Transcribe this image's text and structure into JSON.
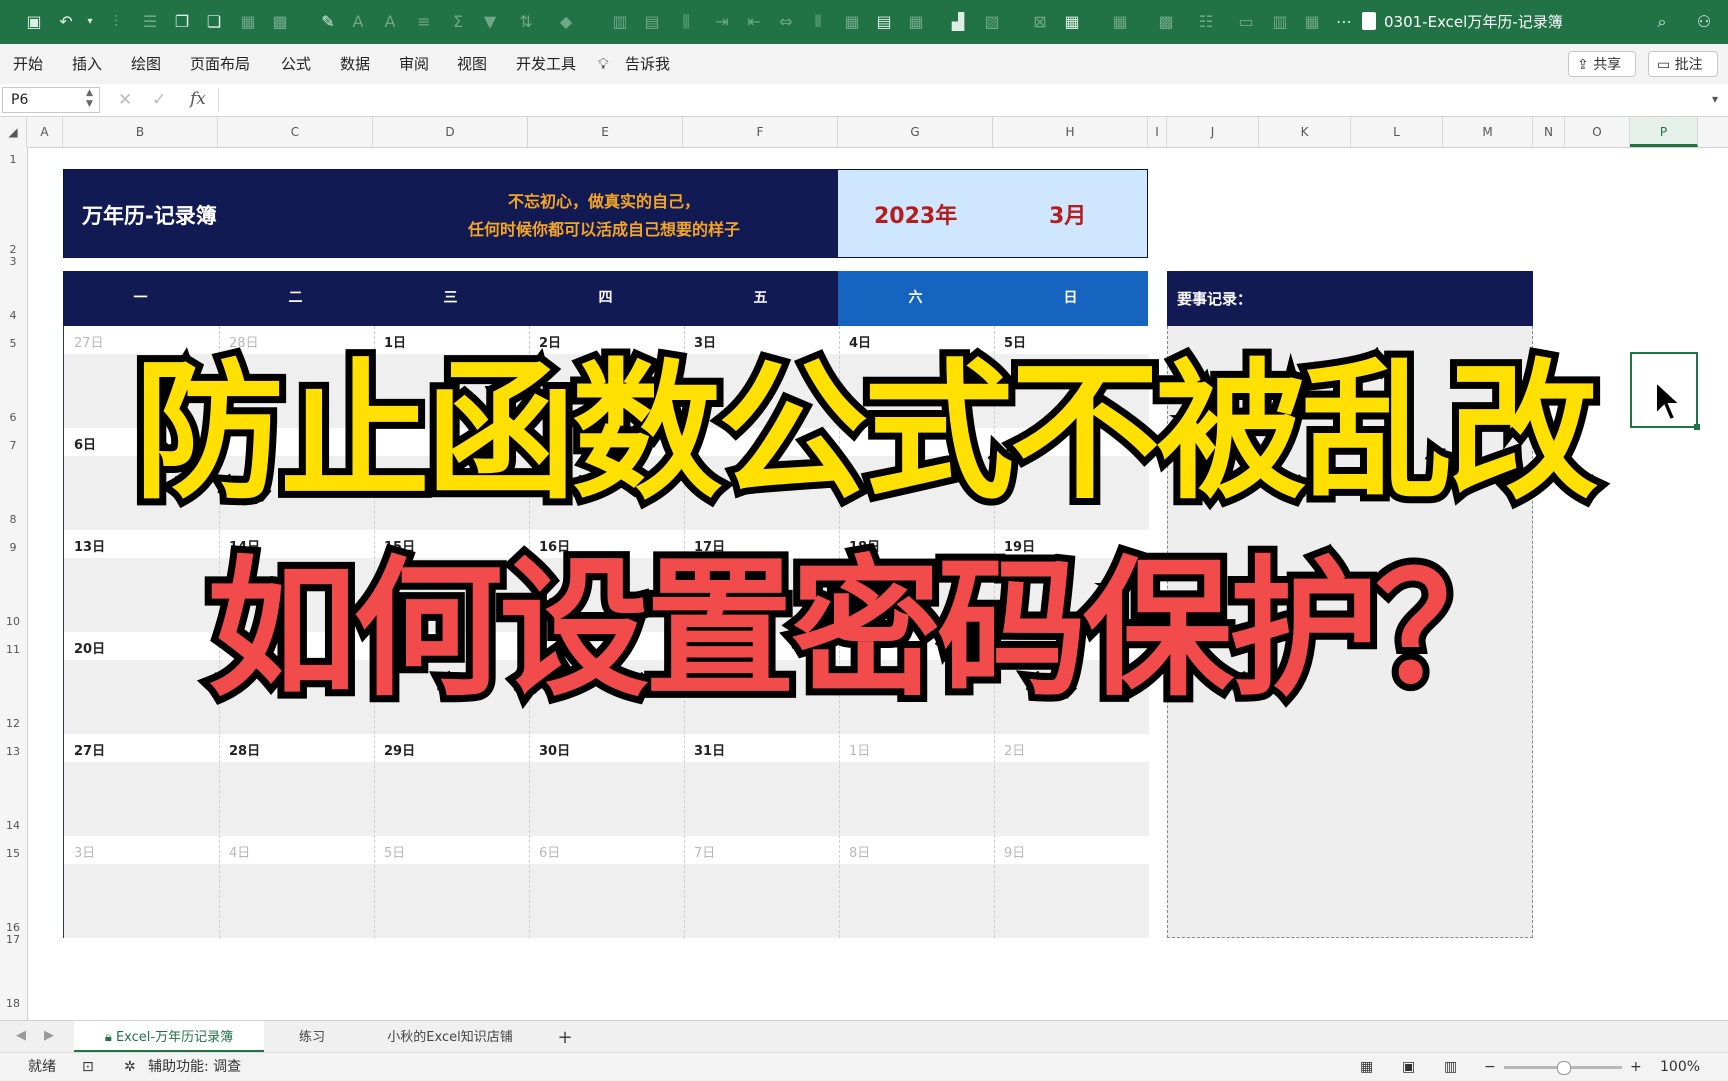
{
  "titlebar": {
    "doc_title": "0301-Excel万年历-记录簿",
    "quick_icons": [
      "save-icon",
      "undo-icon",
      "chevron-down-icon"
    ]
  },
  "ribbon": {
    "tabs": [
      "开始",
      "插入",
      "绘图",
      "页面布局",
      "公式",
      "数据",
      "审阅",
      "视图",
      "开发工具"
    ],
    "tell_me": "告诉我",
    "share": "共享",
    "comment": "批注"
  },
  "formula_bar": {
    "name_box": "P6",
    "fx": "fx",
    "value": ""
  },
  "columns": [
    "A",
    "B",
    "C",
    "D",
    "E",
    "F",
    "G",
    "H",
    "I",
    "J",
    "K",
    "L",
    "M",
    "N",
    "O",
    "P"
  ],
  "rows": [
    "1",
    "2",
    "3",
    "4",
    "5",
    "6",
    "7",
    "8",
    "9",
    "10",
    "11",
    "12",
    "13",
    "14",
    "15",
    "16",
    "17",
    "18"
  ],
  "calendar": {
    "title": "万年历-记录簿",
    "motto_line1": "不忘初心，做真实的自己，",
    "motto_line2": "任何时候你都可以活成自己想要的样子",
    "year": "2023年",
    "month": "3月",
    "weekdays": [
      "一",
      "二",
      "三",
      "四",
      "五",
      "六",
      "日"
    ],
    "weeks": [
      [
        [
          "27日",
          true
        ],
        [
          "28日",
          true
        ],
        [
          "1日",
          false
        ],
        [
          "2日",
          false
        ],
        [
          "3日",
          false
        ],
        [
          "4日",
          false
        ],
        [
          "5日",
          false
        ]
      ],
      [
        [
          "6日",
          false
        ],
        [
          "",
          false
        ],
        [
          "",
          false
        ],
        [
          "",
          false
        ],
        [
          "",
          false
        ],
        [
          "",
          false
        ],
        [
          "",
          false
        ]
      ],
      [
        [
          "13日",
          false
        ],
        [
          "14日",
          false
        ],
        [
          "15日",
          false
        ],
        [
          "16日",
          false
        ],
        [
          "17日",
          false
        ],
        [
          "18日",
          false
        ],
        [
          "19日",
          false
        ]
      ],
      [
        [
          "20日",
          false
        ],
        [
          "",
          false
        ],
        [
          "",
          false
        ],
        [
          "",
          false
        ],
        [
          "",
          false
        ],
        [
          "",
          false
        ],
        [
          "",
          false
        ]
      ],
      [
        [
          "27日",
          false
        ],
        [
          "28日",
          false
        ],
        [
          "29日",
          false
        ],
        [
          "30日",
          false
        ],
        [
          "31日",
          false
        ],
        [
          "1日",
          true
        ],
        [
          "2日",
          true
        ]
      ],
      [
        [
          "3日",
          true
        ],
        [
          "4日",
          true
        ],
        [
          "5日",
          true
        ],
        [
          "6日",
          true
        ],
        [
          "7日",
          true
        ],
        [
          "8日",
          true
        ],
        [
          "9日",
          true
        ]
      ]
    ],
    "notes_label": "要事记录："
  },
  "overlay": {
    "line1": "防止函数公式不被乱改",
    "line2": "如何设置密码保护？"
  },
  "sheet_tabs": {
    "active": "Excel-万年历记录簿",
    "tab2": "练习",
    "tab3": "小秋的Excel知识店铺",
    "add": "+"
  },
  "status": {
    "ready": "就绪",
    "accessibility": "辅助功能: 调查",
    "zoom": "100%"
  }
}
